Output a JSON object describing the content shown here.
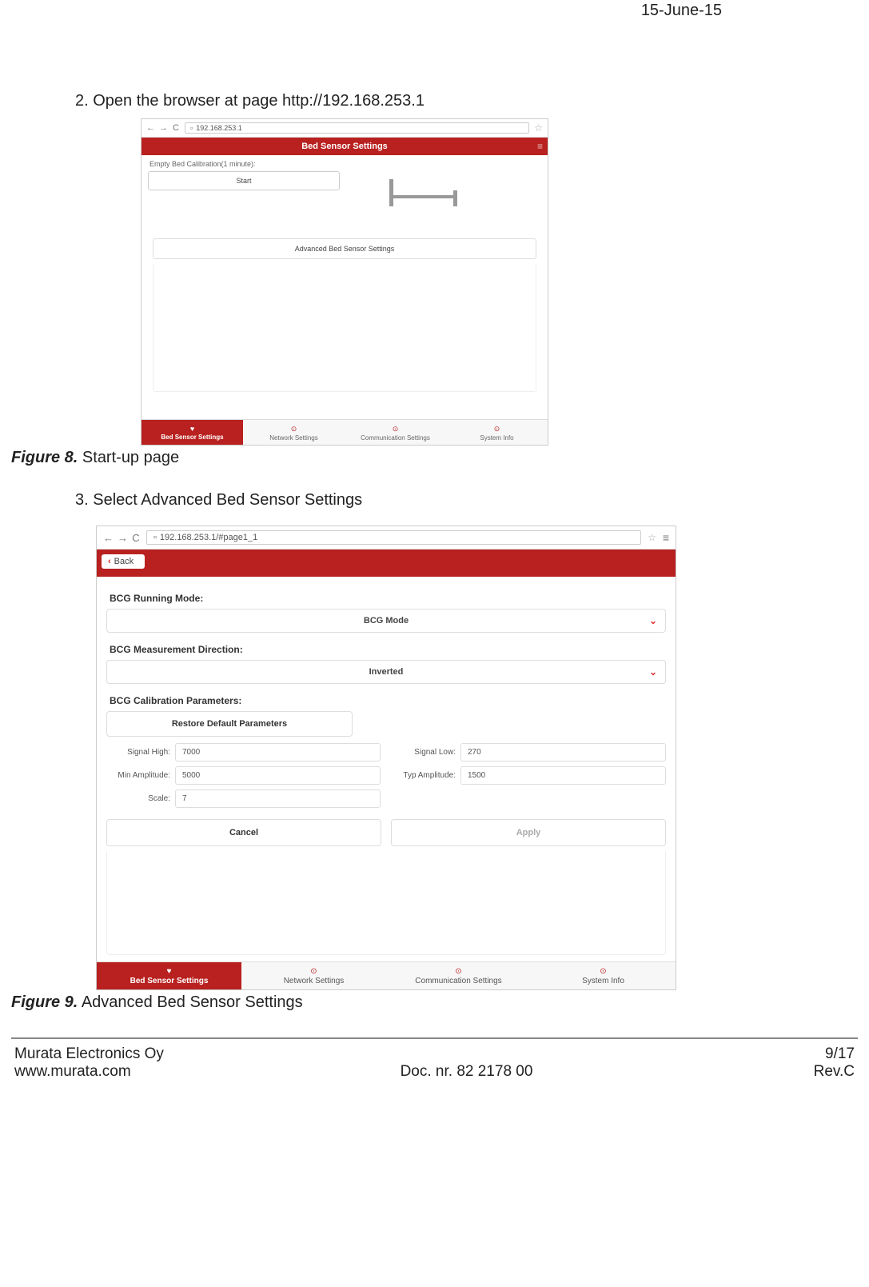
{
  "header_date": "15-June-15",
  "step2_text": "2.  Open the browser at page http://192.168.253.1",
  "step3_text": "3.  Select Advanced Bed Sensor Settings",
  "fig8": {
    "label": "Figure 8.",
    "caption": " Start-up page"
  },
  "fig9": {
    "label": "Figure 9.",
    "caption": " Advanced Bed Sensor Settings"
  },
  "shot1": {
    "url": "192.168.253.1",
    "header": "Bed Sensor Settings",
    "empty_label": "Empty Bed Calibration(1 minute):",
    "start": "Start",
    "advanced": "Advanced Bed Sensor Settings",
    "tabs": [
      "Bed Sensor Settings",
      "Network Settings",
      "Communication Settings",
      "System Info"
    ]
  },
  "shot2": {
    "url": "192.168.253.1/#page1_1",
    "back": "Back",
    "sections": {
      "mode_lbl": "BCG Running Mode:",
      "mode_val": "BCG Mode",
      "dir_lbl": "BCG Measurement Direction:",
      "dir_val": "Inverted",
      "cal_lbl": "BCG Calibration Parameters:",
      "restore": "Restore Default Parameters"
    },
    "params": {
      "signal_high": {
        "lbl": "Signal High:",
        "val": "7000"
      },
      "signal_low": {
        "lbl": "Signal Low:",
        "val": "270"
      },
      "min_amp": {
        "lbl": "Min Amplitude:",
        "val": "5000"
      },
      "typ_amp": {
        "lbl": "Typ Amplitude:",
        "val": "1500"
      },
      "scale": {
        "lbl": "Scale:",
        "val": "7"
      }
    },
    "cancel": "Cancel",
    "apply": "Apply",
    "tabs": [
      "Bed Sensor Settings",
      "Network Settings",
      "Communication Settings",
      "System Info"
    ]
  },
  "footer": {
    "company": "Murata Electronics Oy",
    "site": "www.murata.com",
    "doc": "Doc. nr. 82 2178 00",
    "page": "9/17",
    "rev": "Rev.C"
  }
}
